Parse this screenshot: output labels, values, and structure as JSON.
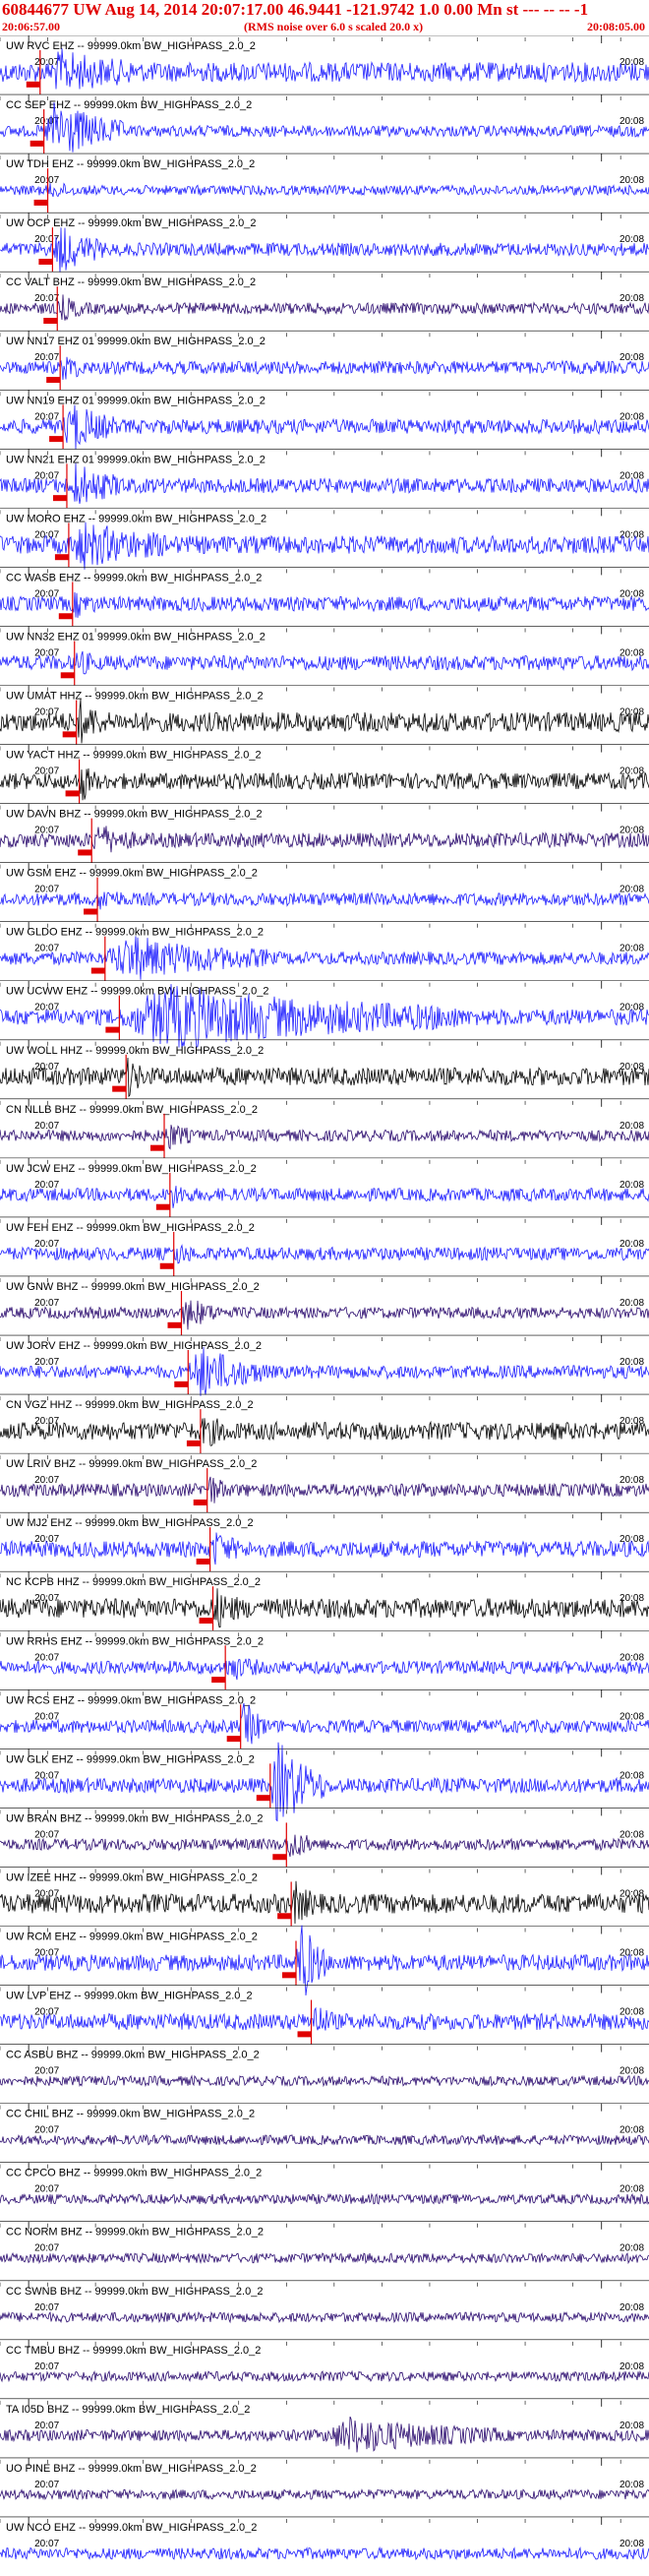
{
  "header": {
    "title": "60844677 UW Aug 14, 2014 20:07:17.00   46.9441 -121.9742  1.0 0.00 Mn st --- -- --  -1",
    "start_time": "20:06:57.00",
    "subtitle": "(RMS noise over 6.0 s scaled 20.0 x)",
    "end_time": "20:08:05.00"
  },
  "chart_data": {
    "type": "line",
    "title": "60844677 UW Aug 14, 2014 20:07:17.00",
    "time_window": [
      "20:06:57.00",
      "20:08:05.00"
    ],
    "event": {
      "origin_time": "20:07:17.00",
      "lat": 46.9441,
      "lon": -121.9742,
      "magnitude": 1.0
    },
    "minute_tick_labels": [
      "20:07",
      "20:08"
    ],
    "colors": {
      "blue": "#1c1cff",
      "purple": "#2a0a6e",
      "black": "#000000",
      "pick": "#e00000"
    },
    "series": [
      {
        "name": "UW RVC EHZ -- 99999.0km BW_HIGHPASS_2.0_2",
        "color": "blue",
        "pick_s": 4.2,
        "amplitude": 0.6,
        "signal": 0.9,
        "signal_start_s": 5,
        "signal_end_s": 14
      },
      {
        "name": "CC SEP EHZ -- 99999.0km BW_HIGHPASS_2.0_2",
        "color": "blue",
        "pick_s": 4.6,
        "amplitude": 0.35,
        "signal": 1.8,
        "signal_start_s": 4.6,
        "signal_end_s": 13
      },
      {
        "name": "UW TDH EHZ -- 99999.0km BW_HIGHPASS_2.0_2",
        "color": "blue",
        "pick_s": 5.0,
        "amplitude": 0.3,
        "signal": 0.3,
        "signal_start_s": 5,
        "signal_end_s": 8
      },
      {
        "name": "UW OCP EHZ -- 99999.0km BW_HIGHPASS_2.0_2",
        "color": "blue",
        "pick_s": 5.5,
        "amplitude": 0.4,
        "signal": 1.2,
        "signal_start_s": 5.5,
        "signal_end_s": 11
      },
      {
        "name": "CC VALT BHZ -- 99999.0km BW_HIGHPASS_2.0_2",
        "color": "purple",
        "pick_s": 6.0,
        "amplitude": 0.35,
        "signal": 0.6,
        "signal_start_s": 6,
        "signal_end_s": 9
      },
      {
        "name": "UW NN17 EHZ 01 99999.0km BW_HIGHPASS_2.0_2",
        "color": "blue",
        "pick_s": 6.3,
        "amplitude": 0.4,
        "signal": 0.6,
        "signal_start_s": 6.3,
        "signal_end_s": 9
      },
      {
        "name": "UW NN19 EHZ 01 99999.0km BW_HIGHPASS_2.0_2",
        "color": "blue",
        "pick_s": 6.6,
        "amplitude": 0.45,
        "signal": 1.3,
        "signal_start_s": 6.6,
        "signal_end_s": 12
      },
      {
        "name": "UW NN21 EHZ 01 99999.0km BW_HIGHPASS_2.0_2",
        "color": "blue",
        "pick_s": 7.0,
        "amplitude": 0.45,
        "signal": 1.1,
        "signal_start_s": 7,
        "signal_end_s": 13
      },
      {
        "name": "UW MORO EHZ -- 99999.0km BW_HIGHPASS_2.0_2",
        "color": "blue",
        "pick_s": 7.2,
        "amplitude": 0.55,
        "signal": 1.0,
        "signal_start_s": 7.2,
        "signal_end_s": 18
      },
      {
        "name": "CC WASB EHZ -- 99999.0km BW_HIGHPASS_2.0_2",
        "color": "blue",
        "pick_s": 7.6,
        "amplitude": 0.45,
        "signal": 0.5,
        "signal_start_s": 7.6,
        "signal_end_s": 10
      },
      {
        "name": "UW NN32 EHZ 01 99999.0km BW_HIGHPASS_2.0_2",
        "color": "blue",
        "pick_s": 7.8,
        "amplitude": 0.45,
        "signal": 0.6,
        "signal_start_s": 7.8,
        "signal_end_s": 10
      },
      {
        "name": "UW UMAT HHZ -- 99999.0km BW_HIGHPASS_2.0_2",
        "color": "black",
        "pick_s": 8.0,
        "amplitude": 0.6,
        "signal": 0.9,
        "signal_start_s": 8,
        "signal_end_s": 11
      },
      {
        "name": "UW YACT HHZ -- 99999.0km BW_HIGHPASS_2.0_2",
        "color": "black",
        "pick_s": 8.3,
        "amplitude": 0.5,
        "signal": 1.0,
        "signal_start_s": 8.3,
        "signal_end_s": 10
      },
      {
        "name": "UW DAVN BHZ -- 99999.0km BW_HIGHPASS_2.0_2",
        "color": "purple",
        "pick_s": 9.6,
        "amplitude": 0.45,
        "signal": 0.7,
        "signal_start_s": 9.6,
        "signal_end_s": 14
      },
      {
        "name": "UW GSM EHZ -- 99999.0km BW_HIGHPASS_2.0_2",
        "color": "blue",
        "pick_s": 10.2,
        "amplitude": 0.4,
        "signal": 0.5,
        "signal_start_s": 10.2,
        "signal_end_s": 13
      },
      {
        "name": "UW GLDO EHZ -- 99999.0km BW_HIGHPASS_2.0_2",
        "color": "blue",
        "pick_s": 11.0,
        "amplitude": 0.4,
        "signal": 1.1,
        "signal_start_s": 11,
        "signal_end_s": 28
      },
      {
        "name": "UW UCWW EHZ -- 99999.0km BW_HIGHPASS_2.0_2",
        "color": "blue",
        "pick_s": 12.5,
        "amplitude": 0.5,
        "signal": 1.6,
        "signal_start_s": 12.5,
        "signal_end_s": 48
      },
      {
        "name": "UW WOLL HHZ -- 99999.0km BW_HIGHPASS_2.0_2",
        "color": "black",
        "pick_s": 13.2,
        "amplitude": 0.55,
        "signal": 0.9,
        "signal_start_s": 13.2,
        "signal_end_s": 15
      },
      {
        "name": "CN NLLB BHZ -- 99999.0km BW_HIGHPASS_2.0_2",
        "color": "purple",
        "pick_s": 17.2,
        "amplitude": 0.35,
        "signal": 0.7,
        "signal_start_s": 17.2,
        "signal_end_s": 20
      },
      {
        "name": "UW JCW EHZ -- 99999.0km BW_HIGHPASS_2.0_2",
        "color": "blue",
        "pick_s": 17.8,
        "amplitude": 0.4,
        "signal": 0.5,
        "signal_start_s": 17.8,
        "signal_end_s": 20
      },
      {
        "name": "UW FEH EHZ -- 99999.0km BW_HIGHPASS_2.0_2",
        "color": "blue",
        "pick_s": 18.2,
        "amplitude": 0.4,
        "signal": 0.5,
        "signal_start_s": 18.2,
        "signal_end_s": 20
      },
      {
        "name": "UW GNW BHZ -- 99999.0km BW_HIGHPASS_2.0_2",
        "color": "purple",
        "pick_s": 19.0,
        "amplitude": 0.35,
        "signal": 0.8,
        "signal_start_s": 19,
        "signal_end_s": 23
      },
      {
        "name": "UW JORV EHZ -- 99999.0km BW_HIGHPASS_2.0_2",
        "color": "blue",
        "pick_s": 19.7,
        "amplitude": 0.4,
        "signal": 1.4,
        "signal_start_s": 19.7,
        "signal_end_s": 28
      },
      {
        "name": "CN VGZ HHZ -- 99999.0km BW_HIGHPASS_2.0_2",
        "color": "black",
        "pick_s": 21.0,
        "amplitude": 0.55,
        "signal": 0.6,
        "signal_start_s": 21,
        "signal_end_s": 24
      },
      {
        "name": "UW LRIV BHZ -- 99999.0km BW_HIGHPASS_2.0_2",
        "color": "purple",
        "pick_s": 21.7,
        "amplitude": 0.4,
        "signal": 0.7,
        "signal_start_s": 21.7,
        "signal_end_s": 24
      },
      {
        "name": "UW MJ2 EHZ -- 99999.0km BW_HIGHPASS_2.0_2",
        "color": "blue",
        "pick_s": 22.0,
        "amplitude": 0.5,
        "signal": 0.8,
        "signal_start_s": 22,
        "signal_end_s": 25
      },
      {
        "name": "NC KCPB HHZ -- 99999.0km BW_HIGHPASS_2.0_2",
        "color": "black",
        "pick_s": 22.3,
        "amplitude": 0.6,
        "signal": 0.8,
        "signal_start_s": 22.3,
        "signal_end_s": 25
      },
      {
        "name": "UW RRHS EHZ -- 99999.0km BW_HIGHPASS_2.0_2",
        "color": "blue",
        "pick_s": 23.6,
        "amplitude": 0.4,
        "signal": 0.6,
        "signal_start_s": 23.6,
        "signal_end_s": 27
      },
      {
        "name": "UW RCS EHZ -- 99999.0km BW_HIGHPASS_2.0_2",
        "color": "blue",
        "pick_s": 25.2,
        "amplitude": 0.4,
        "signal": 1.3,
        "signal_start_s": 25.2,
        "signal_end_s": 28
      },
      {
        "name": "UW GLK EHZ -- 99999.0km BW_HIGHPASS_2.0_2",
        "color": "blue",
        "pick_s": 28.3,
        "amplitude": 0.45,
        "signal": 2.5,
        "signal_start_s": 28.3,
        "signal_end_s": 34
      },
      {
        "name": "UW BRAN BHZ -- 99999.0km BW_HIGHPASS_2.0_2",
        "color": "purple",
        "pick_s": 30.0,
        "amplitude": 0.35,
        "signal": 0.8,
        "signal_start_s": 30,
        "signal_end_s": 33
      },
      {
        "name": "UW IZEE HHZ -- 99999.0km BW_HIGHPASS_2.0_2",
        "color": "black",
        "pick_s": 30.5,
        "amplitude": 0.6,
        "signal": 0.9,
        "signal_start_s": 30.5,
        "signal_end_s": 33
      },
      {
        "name": "UW RCM EHZ -- 99999.0km BW_HIGHPASS_2.0_2",
        "color": "blue",
        "pick_s": 31.0,
        "amplitude": 0.5,
        "signal": 2.5,
        "signal_start_s": 31,
        "signal_end_s": 34
      },
      {
        "name": "UW LVP EHZ -- 99999.0km BW_HIGHPASS_2.0_2",
        "color": "blue",
        "pick_s": 32.6,
        "amplitude": 0.5,
        "signal": 0.8,
        "signal_start_s": 32.6,
        "signal_end_s": 35
      },
      {
        "name": "CC ASBU BHZ -- 99999.0km BW_HIGHPASS_2.0_2",
        "color": "purple",
        "pick_s": null,
        "amplitude": 0.3,
        "signal": 0,
        "signal_start_s": 0,
        "signal_end_s": 0
      },
      {
        "name": "CC CHIL BHZ -- 99999.0km BW_HIGHPASS_2.0_2",
        "color": "purple",
        "pick_s": null,
        "amplitude": 0.3,
        "signal": 0,
        "signal_start_s": 0,
        "signal_end_s": 0
      },
      {
        "name": "CC CPCO BHZ -- 99999.0km BW_HIGHPASS_2.0_2",
        "color": "purple",
        "pick_s": null,
        "amplitude": 0.3,
        "signal": 0,
        "signal_start_s": 0,
        "signal_end_s": 0
      },
      {
        "name": "CC NORM BHZ -- 99999.0km BW_HIGHPASS_2.0_2",
        "color": "purple",
        "pick_s": null,
        "amplitude": 0.3,
        "signal": 0,
        "signal_start_s": 0,
        "signal_end_s": 0
      },
      {
        "name": "CC SWNB BHZ -- 99999.0km BW_HIGHPASS_2.0_2",
        "color": "purple",
        "pick_s": null,
        "amplitude": 0.3,
        "signal": 0,
        "signal_start_s": 0,
        "signal_end_s": 0
      },
      {
        "name": "CC TMBU BHZ -- 99999.0km BW_HIGHPASS_2.0_2",
        "color": "purple",
        "pick_s": null,
        "amplitude": 0.3,
        "signal": 0,
        "signal_start_s": 0,
        "signal_end_s": 0
      },
      {
        "name": "TA I05D BHZ -- 99999.0km BW_HIGHPASS_2.0_2",
        "color": "purple",
        "pick_s": null,
        "amplitude": 0.35,
        "signal": 0.9,
        "signal_start_s": 34,
        "signal_end_s": 52
      },
      {
        "name": "UO PINE BHZ -- 99999.0km BW_HIGHPASS_2.0_2",
        "color": "purple",
        "pick_s": null,
        "amplitude": 0.3,
        "signal": 0,
        "signal_start_s": 0,
        "signal_end_s": 0
      },
      {
        "name": "UW NCO EHZ -- 99999.0km BW_HIGHPASS_2.0_2",
        "color": "blue",
        "pick_s": null,
        "amplitude": 0.35,
        "signal": 0,
        "signal_start_s": 0,
        "signal_end_s": 0
      }
    ]
  }
}
